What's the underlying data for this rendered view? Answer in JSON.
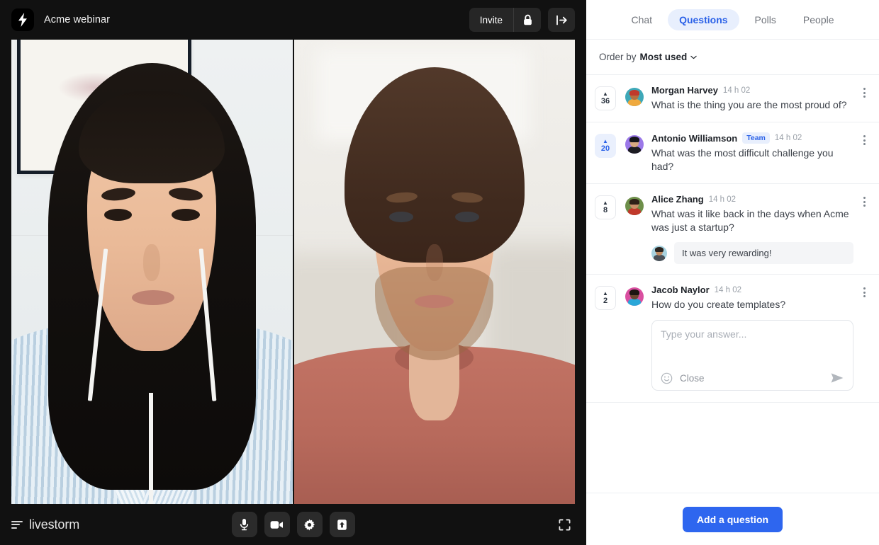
{
  "stage": {
    "brand_icon": "lightning-bolt-icon",
    "room_title": "Acme webinar",
    "header_actions": {
      "invite_label": "Invite",
      "lock_icon": "lock-icon",
      "exit_icon": "exit-icon"
    },
    "footer": {
      "logo_word": "livestorm",
      "controls": [
        {
          "name": "microphone-button",
          "icon": "microphone-icon"
        },
        {
          "name": "camera-button",
          "icon": "video-camera-icon"
        },
        {
          "name": "settings-button",
          "icon": "gear-icon"
        },
        {
          "name": "screen-share-button",
          "icon": "screen-share-icon"
        }
      ],
      "fullscreen_icon": "fullscreen-icon"
    },
    "participants": [
      {
        "name": "participant-video-1"
      },
      {
        "name": "participant-video-2"
      }
    ]
  },
  "panel": {
    "tabs": [
      {
        "label": "Chat",
        "active": false
      },
      {
        "label": "Questions",
        "active": true
      },
      {
        "label": "Polls",
        "active": false
      },
      {
        "label": "People",
        "active": false
      }
    ],
    "order_bar": {
      "label": "Order by",
      "value": "Most used",
      "chevron": "chevron-down-icon"
    },
    "questions": [
      {
        "votes": "36",
        "voted": false,
        "author": "Morgan Harvey",
        "badge": "",
        "time": "14 h 02",
        "text": "What is the thing you are the most proud of?"
      },
      {
        "votes": "20",
        "voted": true,
        "author": "Antonio Williamson",
        "badge": "Team",
        "time": "14 h 02",
        "text": "What was the most difficult challenge you had?"
      },
      {
        "votes": "8",
        "voted": false,
        "author": "Alice Zhang",
        "badge": "",
        "time": "14 h 02",
        "text": "What was it like back in the days when Acme was just a startup?",
        "reply": {
          "text": "It was very rewarding!"
        }
      },
      {
        "votes": "2",
        "voted": false,
        "author": "Jacob Naylor",
        "badge": "",
        "time": "14 h 02",
        "text": "How do you create templates?",
        "composer": {
          "placeholder": "Type your answer...",
          "emoji_icon": "emoji-smiley-icon",
          "close_label": "Close",
          "send_icon": "send-paper-plane-icon"
        }
      }
    ],
    "footer": {
      "add_question_label": "Add a question"
    }
  },
  "colors": {
    "accent": "#2e66ef",
    "accent_soft": "#e8effd",
    "stage_bg": "#111111",
    "panel_bg": "#ffffff",
    "divider": "#edeff2"
  }
}
